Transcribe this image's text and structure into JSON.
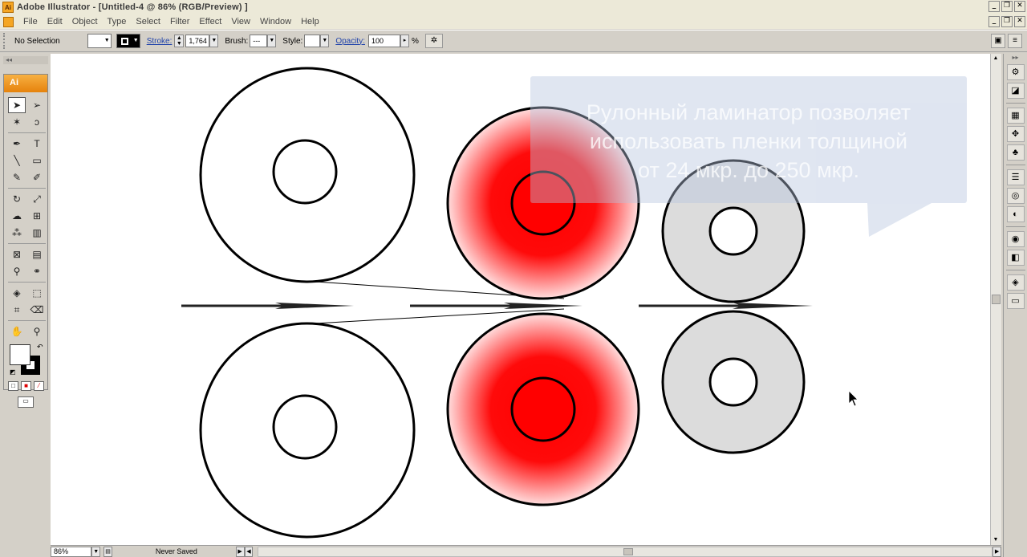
{
  "window": {
    "title": "Adobe Illustrator - [Untitled-4 @ 86% (RGB/Preview) ]",
    "app_badge": "Ai"
  },
  "menu": [
    "File",
    "Edit",
    "Object",
    "Type",
    "Select",
    "Filter",
    "Effect",
    "View",
    "Window",
    "Help"
  ],
  "control_bar": {
    "selection_label": "No Selection",
    "stroke_label": "Stroke:",
    "stroke_value": "1,764",
    "brush_label": "Brush:",
    "brush_value": "---",
    "style_label": "Style:",
    "opacity_label": "Opacity:",
    "opacity_value": "100",
    "percent": "%"
  },
  "tools": {
    "logo": "Ai",
    "items": [
      {
        "name": "selection-tool",
        "glyph": "➤",
        "active": true
      },
      {
        "name": "direct-selection-tool",
        "glyph": "➢"
      },
      {
        "name": "magic-wand-tool",
        "glyph": "✶"
      },
      {
        "name": "lasso-tool",
        "glyph": "ↄ"
      },
      {
        "name": "pen-tool",
        "glyph": "✒"
      },
      {
        "name": "type-tool",
        "glyph": "T"
      },
      {
        "name": "line-segment-tool",
        "glyph": "╲"
      },
      {
        "name": "rectangle-tool",
        "glyph": "▭"
      },
      {
        "name": "paintbrush-tool",
        "glyph": "✎"
      },
      {
        "name": "pencil-tool",
        "glyph": "✐"
      },
      {
        "name": "rotate-tool",
        "glyph": "↻"
      },
      {
        "name": "scale-tool",
        "glyph": "⤢"
      },
      {
        "name": "warp-tool",
        "glyph": "☁"
      },
      {
        "name": "free-transform-tool",
        "glyph": "⊞"
      },
      {
        "name": "symbol-sprayer-tool",
        "glyph": "⁂"
      },
      {
        "name": "column-graph-tool",
        "glyph": "▥"
      },
      {
        "name": "mesh-tool",
        "glyph": "⊠"
      },
      {
        "name": "gradient-tool",
        "glyph": "▤"
      },
      {
        "name": "eyedropper-tool",
        "glyph": "⚲"
      },
      {
        "name": "blend-tool",
        "glyph": "⚭"
      },
      {
        "name": "live-paint-bucket-tool",
        "glyph": "◈"
      },
      {
        "name": "live-paint-selection-tool",
        "glyph": "⬚"
      },
      {
        "name": "slice-tool",
        "glyph": "⌗"
      },
      {
        "name": "eraser-tool",
        "glyph": "⌫"
      },
      {
        "name": "hand-tool",
        "glyph": "✋"
      },
      {
        "name": "zoom-tool",
        "glyph": "⚲"
      }
    ]
  },
  "canvas": {
    "overlay_text_line1": "Рулонный ламинатор позволяет",
    "overlay_text_line2": "использовать пленки толщиной",
    "overlay_text_line3": "от 24 мкр. до 250 мкр.",
    "colors": {
      "red": "#ff0000",
      "grey_fill": "#dcdcdc",
      "stroke": "#000000",
      "overlay": "#b4c3de"
    }
  },
  "status": {
    "zoom": "86%",
    "save_state": "Never Saved"
  },
  "dock_icons": [
    "navigator-icon",
    "info-icon",
    "swatches-icon",
    "brushes-icon",
    "symbols-icon",
    "stroke-icon",
    "gradient-icon",
    "transparency-icon",
    "appearance-icon",
    "graphic-styles-icon",
    "layers-icon",
    "artboards-icon"
  ]
}
